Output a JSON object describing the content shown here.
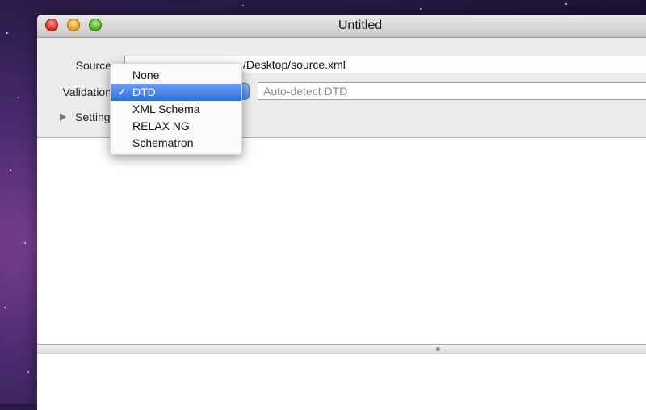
{
  "window": {
    "title": "Untitled"
  },
  "form": {
    "source_label": "Source",
    "source_value": "/Desktop/source.xml",
    "validation_label": "Validation",
    "dtd_placeholder": "Auto-detect DTD",
    "settings_label": "Setting"
  },
  "validation_menu": {
    "selected": "DTD",
    "check_glyph": "✓",
    "items": [
      "None",
      "DTD",
      "XML Schema",
      "RELAX NG",
      "Schematron"
    ]
  },
  "colors": {
    "selection": "#2d6fe0",
    "desktop": "#4a2a6e"
  }
}
